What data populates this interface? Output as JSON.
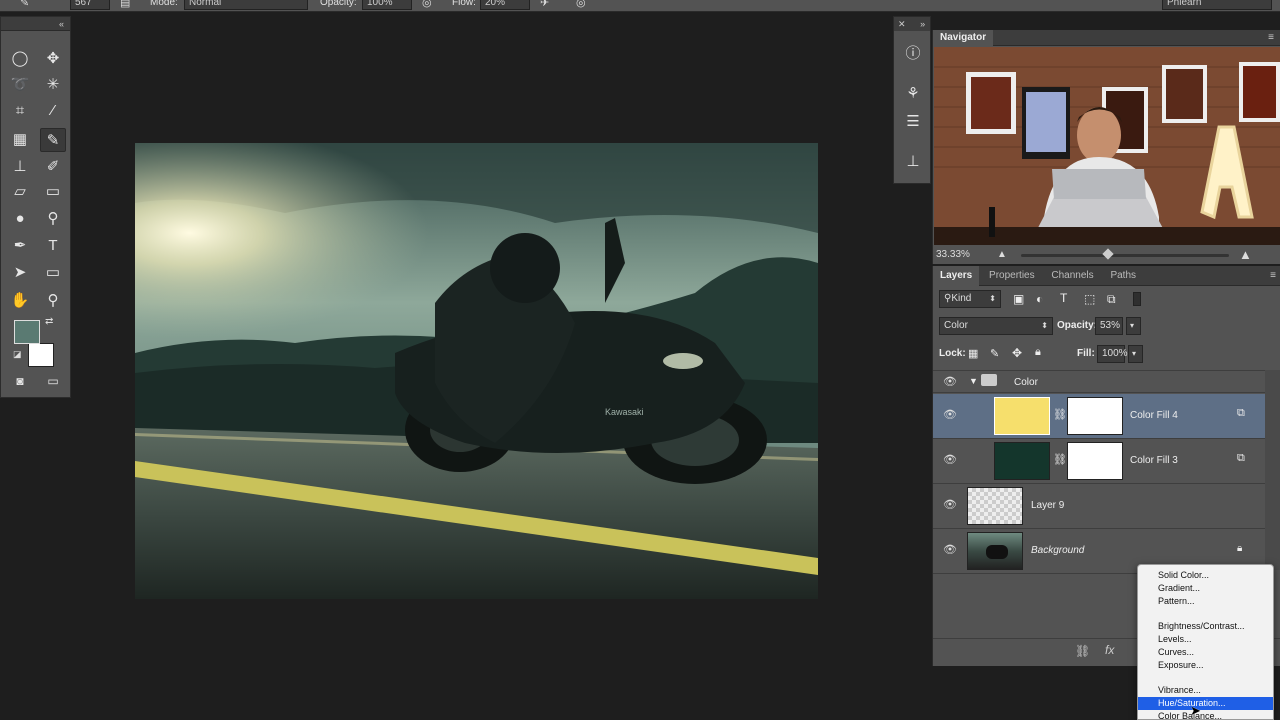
{
  "options_bar": {
    "brush_size": "567",
    "mode_label": "Mode:",
    "mode_value": "Normal",
    "opacity_label": "Opacity:",
    "opacity_value": "100%",
    "flow_label": "Flow:",
    "flow_value": "20%",
    "workspace": "Phlearn"
  },
  "toolbox": {
    "collapse": "«"
  },
  "navigator": {
    "tab": "Navigator",
    "zoom": "33.33%",
    "zoom_slider_level": 0.42
  },
  "layers": {
    "tabs": [
      "Layers",
      "Properties",
      "Channels",
      "Paths"
    ],
    "filter_kind": "Kind",
    "blend_mode": "Color",
    "opacity_label": "Opacity:",
    "opacity_value": "53%",
    "lock_label": "Lock:",
    "fill_label": "Fill:",
    "fill_value": "100%",
    "group_name": "Color",
    "rows": [
      {
        "name": "Color Fill 4",
        "color": "#f6df6c",
        "selected": true
      },
      {
        "name": "Color Fill 3",
        "color": "#14362c",
        "selected": false
      },
      {
        "name": "Layer 9",
        "selected": false
      },
      {
        "name": "Background",
        "selected": false
      }
    ],
    "fx": "fx"
  },
  "context_menu": {
    "items": [
      "Solid Color...",
      "Gradient...",
      "Pattern...",
      "Brightness/Contrast...",
      "Levels...",
      "Curves...",
      "Exposure...",
      "Vibrance...",
      "Hue/Saturation...",
      "Color Balance..."
    ],
    "highlighted_index": 8
  },
  "colors": {
    "foreground": "#5a7a72",
    "background": "#ffffff",
    "menu_highlight": "#1f5fe6",
    "selected_layer": "#5e6f86"
  }
}
